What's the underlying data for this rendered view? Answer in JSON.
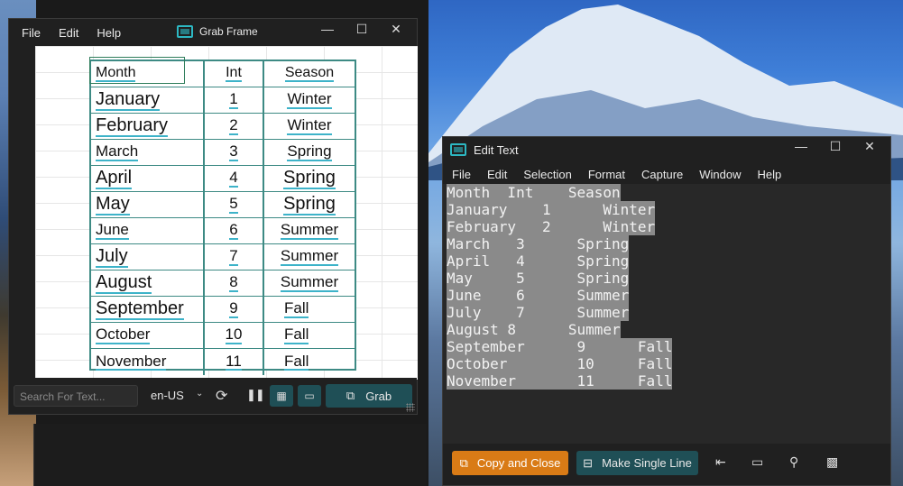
{
  "grab_frame": {
    "menu": [
      "File",
      "Edit",
      "Help"
    ],
    "title": "Grab Frame",
    "table": {
      "headers": [
        "Month",
        "Int",
        "Season"
      ],
      "rows": [
        [
          "January",
          "1",
          "Winter"
        ],
        [
          "February",
          "2",
          "Winter"
        ],
        [
          "March",
          "3",
          "Spring"
        ],
        [
          "April",
          "4",
          "Spring"
        ],
        [
          "May",
          "5",
          "Spring"
        ],
        [
          "June",
          "6",
          "Summer"
        ],
        [
          "July",
          "7",
          "Summer"
        ],
        [
          "August",
          "8",
          "Summer"
        ],
        [
          "September",
          "9",
          "Fall"
        ],
        [
          "October",
          "10",
          "Fall"
        ],
        [
          "November",
          "11",
          "Fall"
        ]
      ]
    },
    "search_placeholder": "Search For Text...",
    "language": "en-US",
    "grab_label": "Grab"
  },
  "edit_text": {
    "title": "Edit Text",
    "menu": [
      "File",
      "Edit",
      "Selection",
      "Format",
      "Capture",
      "Window",
      "Help"
    ],
    "lines": [
      "Month  Int    Season",
      "January    1      Winter",
      "February   2      Winter",
      "March   3      Spring",
      "April   4      Spring",
      "May     5      Spring",
      "June    6      Summer",
      "July    7      Summer",
      "August 8      Summer",
      "September      9      Fall",
      "October        10     Fall",
      "November       11     Fall"
    ],
    "copy_close_label": "Copy and Close",
    "single_line_label": "Make Single Line"
  },
  "colors": {
    "accent_teal": "#1f4f56",
    "accent_orange": "#d97b16",
    "table_border": "#3d8a84"
  }
}
